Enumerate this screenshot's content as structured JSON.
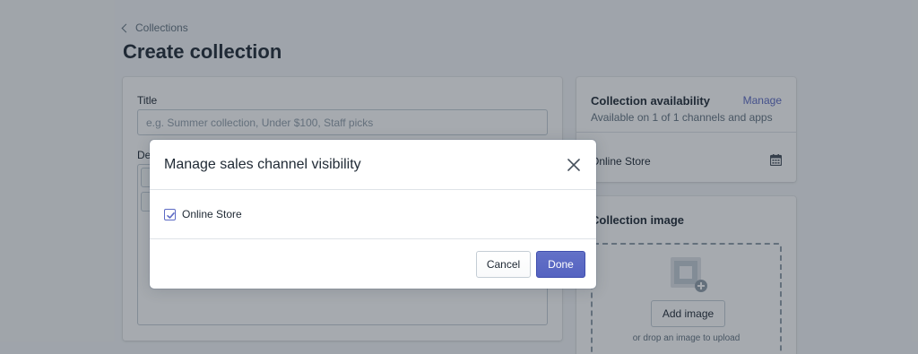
{
  "background": {
    "breadcrumb": "Collections",
    "page_title": "Create collection",
    "main_card": {
      "title_label": "Title",
      "title_placeholder": "e.g. Summer collection, Under $100, Staff picks",
      "description_label": "De"
    },
    "availability": {
      "title": "Collection availability",
      "manage_link": "Manage",
      "subtitle": "Available on 1 of 1 channels and apps",
      "channel": "Online Store",
      "calendar_icon": "calendar-icon"
    },
    "image_card": {
      "title": "Collection image",
      "add_button": "Add image",
      "hint": "or drop an image to upload",
      "image_icon": "image-placeholder-icon"
    }
  },
  "modal": {
    "title": "Manage sales channel visibility",
    "close_icon": "close-icon",
    "channels": [
      {
        "label": "Online Store",
        "checked": true
      }
    ],
    "cancel_label": "Cancel",
    "done_label": "Done"
  },
  "colors": {
    "accent": "#5c6ac4",
    "overlay": "rgba(33,43,54,0.4)",
    "page_bg": "#f4f6f8"
  }
}
